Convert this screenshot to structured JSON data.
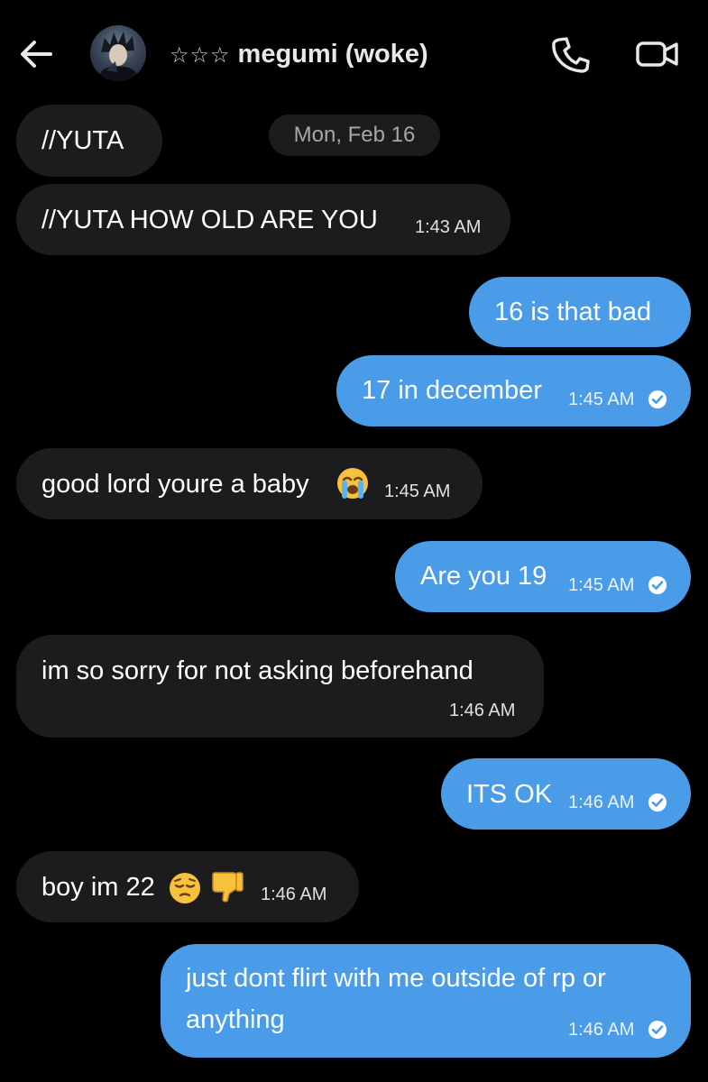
{
  "header": {
    "stars": "☆☆☆",
    "contact_name": "megumi (woke)",
    "back_icon": "arrow-left-icon",
    "call_icon": "phone-icon",
    "video_icon": "video-camera-icon"
  },
  "date_separator": "Mon, Feb 16",
  "colors": {
    "background": "#000000",
    "incoming_bubble": "#1c1c1e",
    "outgoing_bubble": "#4a9ce8",
    "date_pill": "#1c1c1e"
  },
  "messages": [
    {
      "dir": "in",
      "text": "//YUTA",
      "time": ""
    },
    {
      "dir": "in",
      "text": "//YUTA HOW OLD ARE YOU",
      "time": "1:43 AM"
    },
    {
      "dir": "out",
      "text": "16 is that bad",
      "time": ""
    },
    {
      "dir": "out",
      "text": "17 in december",
      "time": "1:45 AM",
      "read": true
    },
    {
      "dir": "in",
      "text": "good lord youre a baby",
      "emoji": "loudly-crying-face",
      "time": "1:45 AM"
    },
    {
      "dir": "out",
      "text": "Are you 19",
      "time": "1:45 AM",
      "read": true
    },
    {
      "dir": "in",
      "text": "im so sorry for not asking beforehand",
      "time": "1:46 AM"
    },
    {
      "dir": "out",
      "text": "ITS OK",
      "time": "1:46 AM",
      "read": true
    },
    {
      "dir": "in",
      "text": "boy im 22",
      "emoji": "pensive-face thumbs-down",
      "time": "1:46 AM"
    },
    {
      "dir": "out",
      "text_line1": "just dont flirt with me outside of rp or",
      "text_line2": "anything",
      "time": "1:46 AM",
      "read": true
    }
  ]
}
